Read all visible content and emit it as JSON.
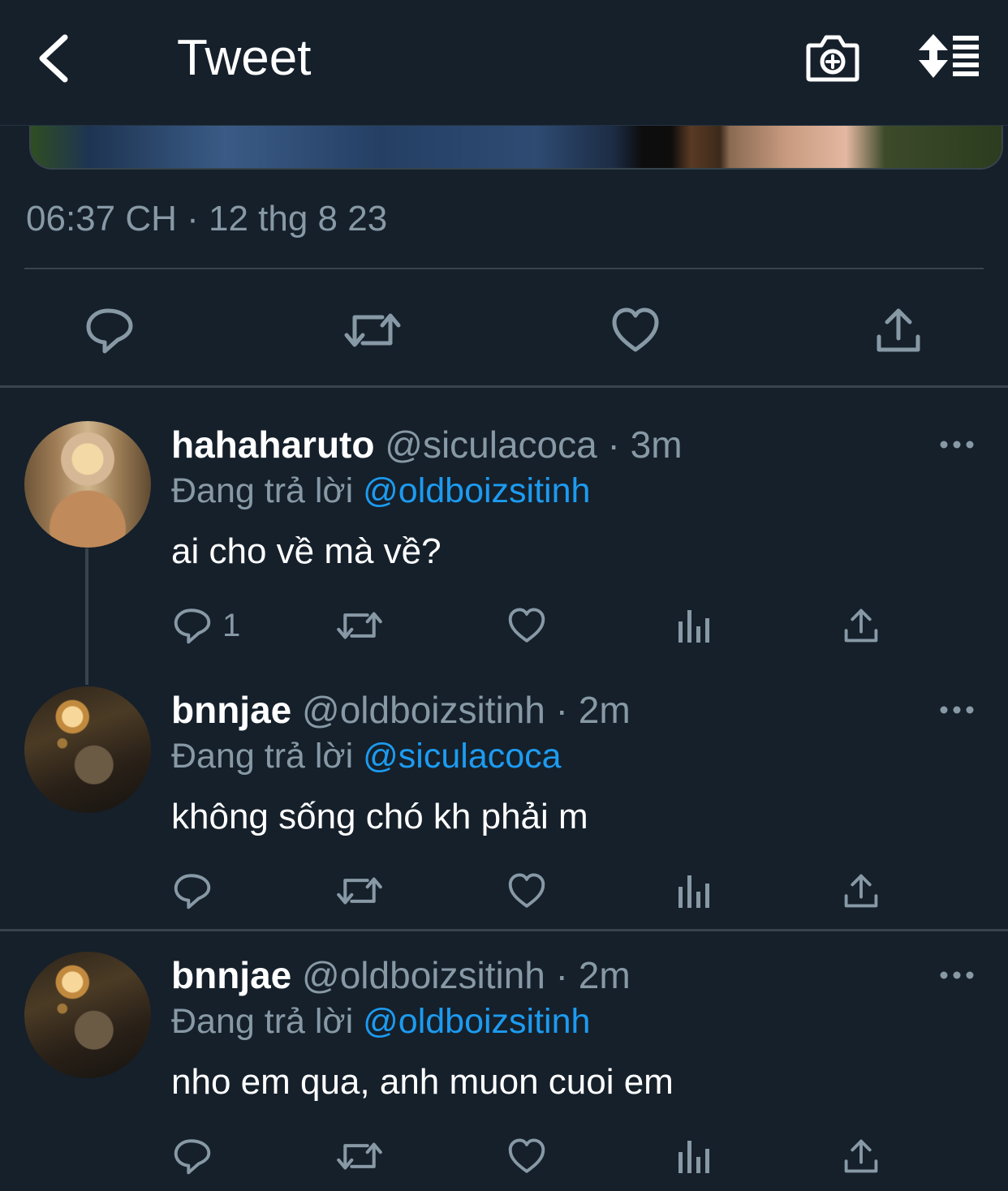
{
  "header": {
    "title": "Tweet"
  },
  "colors": {
    "background": "#15202b",
    "divider": "#38444d",
    "muted": "#8899a6",
    "mention": "#1d9bf0"
  },
  "tweet": {
    "timestamp": "06:37 CH · 12 thg 8 23"
  },
  "icons": [
    "back-arrow-icon",
    "camera-plus-icon",
    "sort-list-icon",
    "comment-icon",
    "retweet-icon",
    "heart-icon",
    "share-icon",
    "analytics-icon",
    "more-icon"
  ],
  "replies": [
    {
      "display_name": "hahaharuto",
      "handle": "@siculacoca",
      "separator": "·",
      "time": "3m",
      "replying_prefix": "Đang trả lời",
      "replying_to": "@oldboizsitinh",
      "text": "ai cho về mà về?",
      "reply_count": "1"
    },
    {
      "display_name": "bnnjae",
      "handle": "@oldboizsitinh",
      "separator": "·",
      "time": "2m",
      "replying_prefix": "Đang trả lời",
      "replying_to": "@siculacoca",
      "text": "không sống chó kh phải m",
      "reply_count": ""
    },
    {
      "display_name": "bnnjae",
      "handle": "@oldboizsitinh",
      "separator": "·",
      "time": "2m",
      "replying_prefix": "Đang trả lời",
      "replying_to": "@oldboizsitinh",
      "text": "nho em qua, anh muon cuoi em",
      "reply_count": ""
    }
  ]
}
